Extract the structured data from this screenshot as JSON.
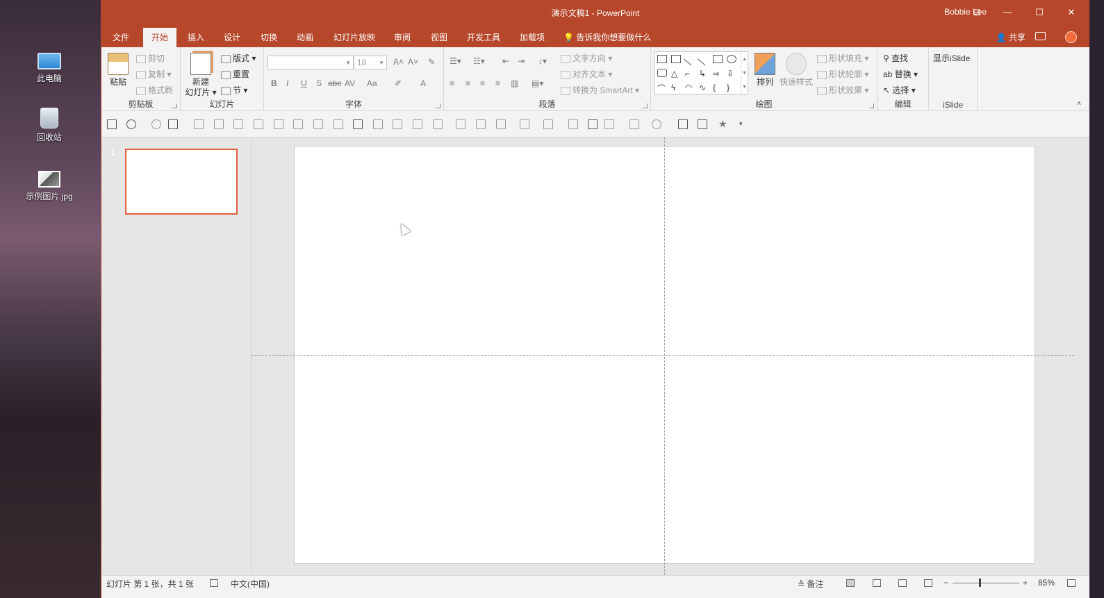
{
  "desktop": {
    "icons": [
      {
        "label": "此电脑",
        "icon": "computer-icon"
      },
      {
        "label": "回收站",
        "icon": "recycle-bin-icon"
      },
      {
        "label": "示例图片.jpg",
        "icon": "image-file-icon"
      }
    ]
  },
  "window": {
    "title": "演示文稿1  -  PowerPoint",
    "user": "Bobbie Lee",
    "accent": "#b7472a"
  },
  "tabs": [
    "文件",
    "开始",
    "插入",
    "设计",
    "切换",
    "动画",
    "幻灯片放映",
    "审阅",
    "视图",
    "开发工具",
    "加载项"
  ],
  "active_tab": "开始",
  "tell_me": "告诉我你想要做什么",
  "share": "共享",
  "ribbon": {
    "clipboard": {
      "label": "剪贴板",
      "paste": "粘贴",
      "cut": "剪切",
      "copy": "复制",
      "format_painter": "格式刷"
    },
    "slides": {
      "label": "幻灯片",
      "new_slide_1": "新建",
      "new_slide_2": "幻灯片",
      "layout": "版式",
      "reset": "重置",
      "section": "节"
    },
    "font": {
      "label": "字体",
      "font_name": "",
      "font_size": "18",
      "bold": "B",
      "italic": "I",
      "underline": "U",
      "shadow": "S",
      "strike": "abc",
      "spacing": "AV",
      "case": "Aa",
      "color": "A"
    },
    "paragraph": {
      "label": "段落",
      "text_direction": "文字方向",
      "align_text": "对齐文本",
      "smartart": "转换为 SmartArt"
    },
    "drawing": {
      "label": "绘图",
      "arrange": "排列",
      "quick_styles": "快速样式",
      "fill": "形状填充",
      "outline": "形状轮廓",
      "effects": "形状效果"
    },
    "editing": {
      "label": "编辑",
      "find": "查找",
      "replace": "替换",
      "select": "选择"
    },
    "islide": {
      "label": "iSlide",
      "show": "显示iSlide"
    }
  },
  "thumbnails": {
    "number": "1"
  },
  "status": {
    "slide_info": "幻灯片 第 1 张，共 1 张",
    "language": "中文(中国)",
    "notes": "备注",
    "zoom": "85%"
  }
}
